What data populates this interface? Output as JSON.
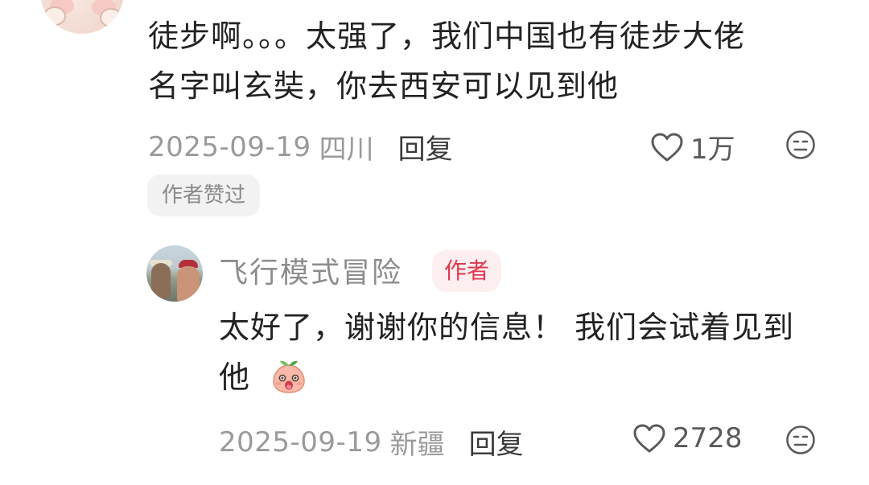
{
  "top_comment": {
    "text_line1": "徒步啊。。。太强了，我们中国也有徒步大佬",
    "text_line2": "名字叫玄奘，你去西安可以见到他",
    "date": "2025-09-19",
    "location": "四川",
    "reply_label": "回复",
    "like_count": "1万",
    "author_liked_badge": "作者赞过"
  },
  "reply_comment": {
    "author_name": "飞行模式冒险",
    "author_tag": "作者",
    "text_line1": "太好了，谢谢你的信息！ 我们会试着见到",
    "text_line2": "他",
    "date": "2025-09-19",
    "location": "新疆",
    "reply_label": "回复",
    "like_count": "2728"
  },
  "icons": {
    "like": "heart-outline-icon",
    "dislike": "meh-face-icon",
    "emoji": "peach-face-emoji"
  },
  "colors": {
    "text_primary": "#222222",
    "text_meta": "#9a9a9a",
    "author_tag_text": "#e0384e",
    "author_tag_bg": "#fdeef0",
    "badge_bg": "#f2f2f2"
  }
}
